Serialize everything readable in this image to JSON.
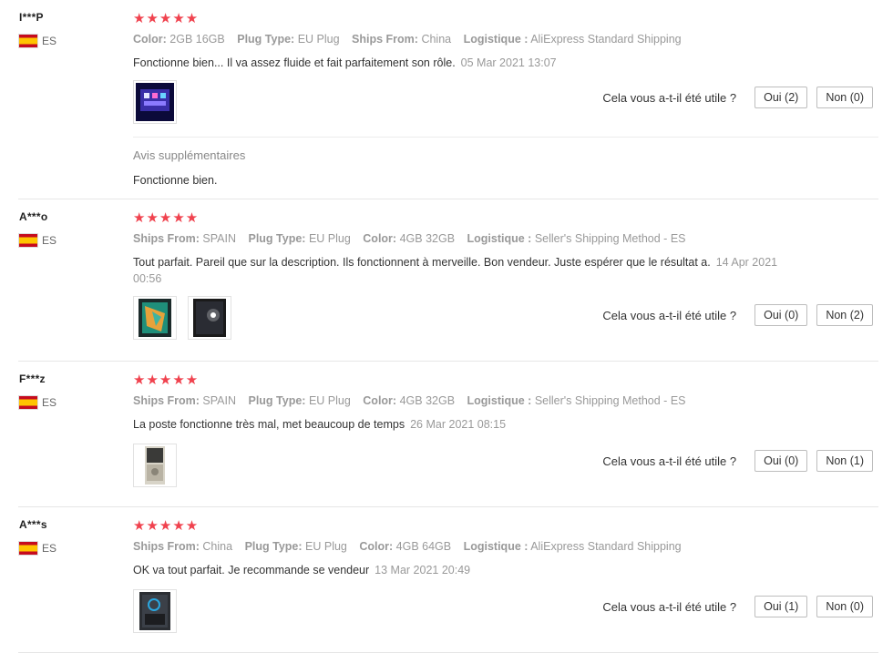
{
  "helpful_question": "Cela vous a-t-il été utile ?",
  "reviews": [
    {
      "user": "I***P",
      "country": "ES",
      "stars": "★★★★★",
      "props": [
        {
          "k": "Color:",
          "v": "2GB 16GB"
        },
        {
          "k": "Plug Type:",
          "v": "EU Plug"
        },
        {
          "k": "Ships From:",
          "v": "China"
        },
        {
          "k": "Logistique :",
          "v": "AliExpress Standard Shipping"
        }
      ],
      "text": "Fonctionne bien... Il va assez fluide et fait parfaitement son rôle.",
      "date": "05 Mar 2021 13:07",
      "yes": "Oui (2)",
      "no": "Non (0)",
      "extra_title": "Avis supplémentaires",
      "extra_text": "Fonctionne bien."
    },
    {
      "user": "A***o",
      "country": "ES",
      "stars": "★★★★★",
      "props": [
        {
          "k": "Ships From:",
          "v": "SPAIN"
        },
        {
          "k": "Plug Type:",
          "v": "EU Plug"
        },
        {
          "k": "Color:",
          "v": "4GB 32GB"
        },
        {
          "k": "Logistique :",
          "v": "Seller's Shipping Method - ES"
        }
      ],
      "text": "Tout parfait. Pareil que sur la description. Ils fonctionnent à merveille. Bon vendeur. Juste espérer que le résultat a.",
      "date": "14 Apr 2021 00:56",
      "yes": "Oui (0)",
      "no": "Non (2)"
    },
    {
      "user": "F***z",
      "country": "ES",
      "stars": "★★★★★",
      "props": [
        {
          "k": "Ships From:",
          "v": "SPAIN"
        },
        {
          "k": "Plug Type:",
          "v": "EU Plug"
        },
        {
          "k": "Color:",
          "v": "4GB 32GB"
        },
        {
          "k": "Logistique :",
          "v": "Seller's Shipping Method - ES"
        }
      ],
      "text": "La poste fonctionne très mal, met beaucoup de temps",
      "date": "26 Mar 2021 08:15",
      "yes": "Oui (0)",
      "no": "Non (1)"
    },
    {
      "user": "A***s",
      "country": "ES",
      "stars": "★★★★★",
      "props": [
        {
          "k": "Ships From:",
          "v": "China"
        },
        {
          "k": "Plug Type:",
          "v": "EU Plug"
        },
        {
          "k": "Color:",
          "v": "4GB 64GB"
        },
        {
          "k": "Logistique :",
          "v": "AliExpress Standard Shipping"
        }
      ],
      "text": "OK va tout parfait. Je recommande se vendeur",
      "date": "13 Mar 2021 20:49",
      "yes": "Oui (1)",
      "no": "Non (0)"
    }
  ],
  "colors": {
    "stars": "#f0424e",
    "muted": "#999999",
    "border": "#e6e6e6"
  }
}
